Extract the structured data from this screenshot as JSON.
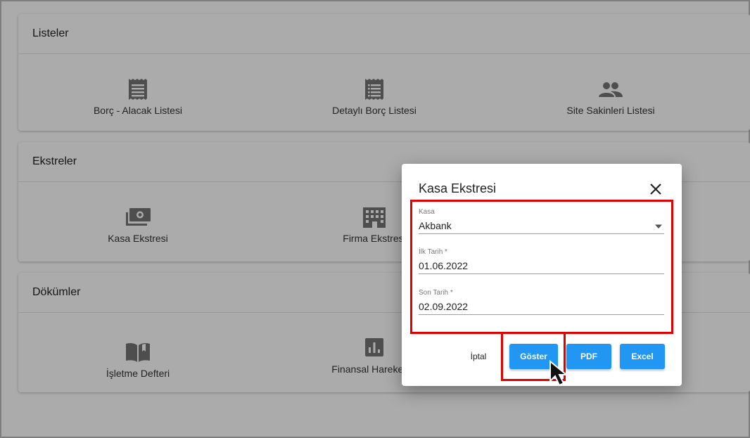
{
  "sections": [
    {
      "title": "Listeler",
      "items": [
        {
          "label": "Borç - Alacak Listesi",
          "icon": "receipt-icon"
        },
        {
          "label": "Detaylı Borç Listesi",
          "icon": "receipt-icon"
        },
        {
          "label": "Site Sakinleri Listesi",
          "icon": "people-icon"
        }
      ]
    },
    {
      "title": "Ekstreler",
      "items": [
        {
          "label": "Kasa Ekstresi",
          "icon": "cash-icon"
        },
        {
          "label": "Firma Ekstresi",
          "icon": "building-icon"
        }
      ]
    },
    {
      "title": "Dökümler",
      "items": [
        {
          "label": "İşletme Defteri",
          "icon": "book-icon"
        },
        {
          "label": "Finansal Hareketler",
          "icon": "bar-chart-icon"
        }
      ]
    }
  ],
  "dialog": {
    "title": "Kasa Ekstresi",
    "fields": [
      {
        "label": "Kasa",
        "value": "Akbank"
      },
      {
        "label": "İlk Tarih *",
        "value": "01.06.2022"
      },
      {
        "label": "Son Tarih *",
        "value": "02.09.2022"
      }
    ],
    "buttons": {
      "cancel": "İptal",
      "show": "Göster",
      "pdf": "PDF",
      "excel": "Excel"
    }
  },
  "colors": {
    "primary": "#2196f3",
    "highlight": "#e00000",
    "icon": "#757575"
  }
}
